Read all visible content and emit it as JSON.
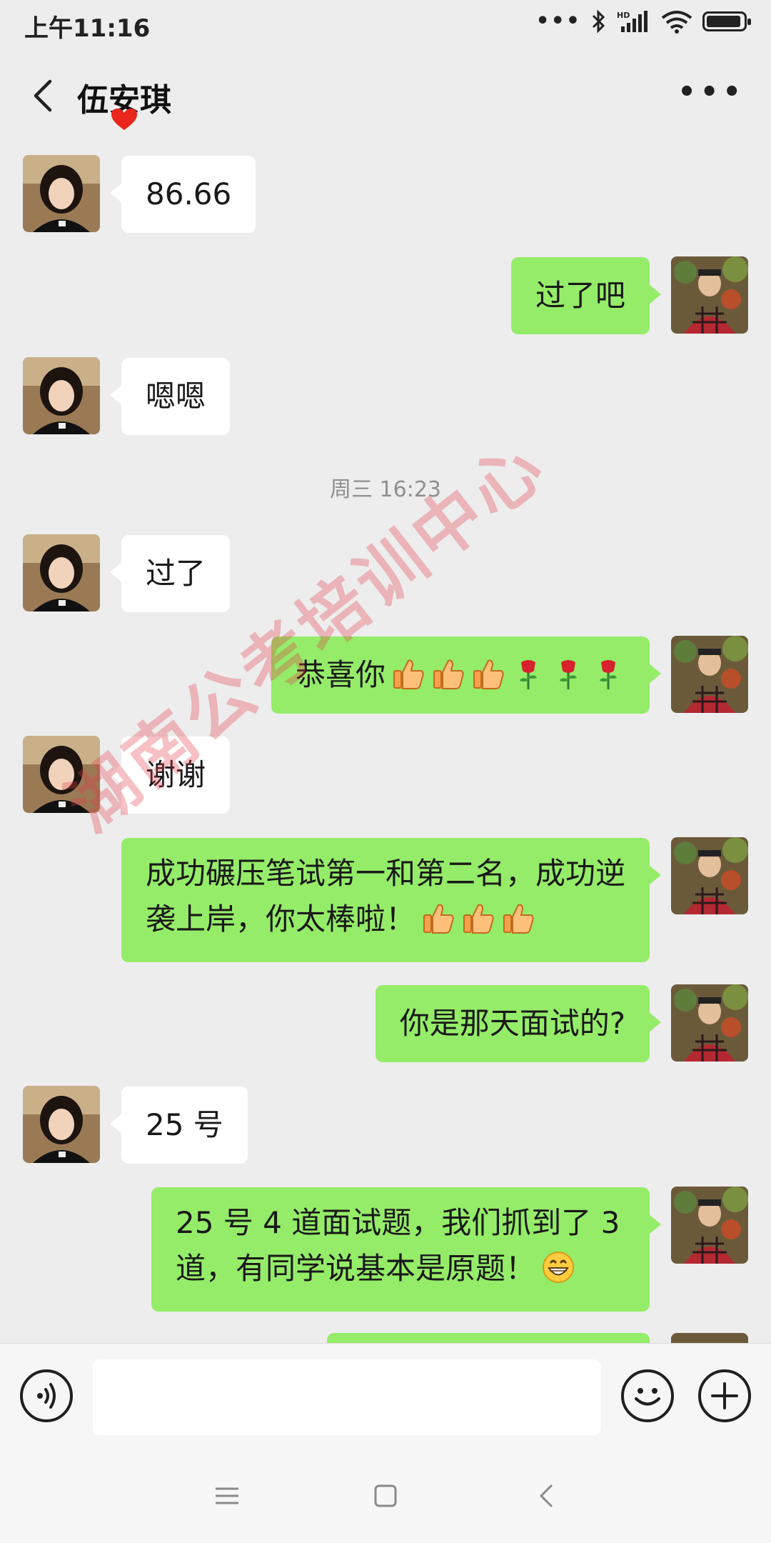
{
  "status_bar": {
    "time": "上午11:16",
    "icons": [
      "signal-dots-icon",
      "bluetooth-icon",
      "hd-signal-icon",
      "wifi-icon",
      "battery-icon"
    ]
  },
  "header": {
    "title": "伍安琪",
    "back_icon": "chevron-left-icon",
    "more_icon": "more-dots-icon"
  },
  "messages": [
    {
      "side": "left",
      "text": "86.66"
    },
    {
      "side": "right",
      "text": "过了吧"
    },
    {
      "side": "left",
      "text": "嗯嗯"
    },
    {
      "type": "timestamp",
      "text": "周三 16:23"
    },
    {
      "side": "left",
      "text": "过了"
    },
    {
      "side": "right",
      "text": "恭喜你",
      "emojis": [
        "thumbs-up",
        "thumbs-up",
        "thumbs-up",
        "rose",
        "rose",
        "rose"
      ]
    },
    {
      "side": "left",
      "text": "谢谢"
    },
    {
      "side": "right",
      "text": "成功碾压笔试第一和第二名，成功逆袭上岸，你太棒啦！",
      "emojis": [
        "thumbs-up",
        "thumbs-up",
        "thumbs-up"
      ]
    },
    {
      "side": "right",
      "text": "你是那天面试的?"
    },
    {
      "side": "left",
      "text": "25 号"
    },
    {
      "side": "right",
      "text": "25 号 4 道面试题，我们抓到了 3 道，有同学说基本是原题！",
      "emojis": [
        "grin"
      ]
    }
  ],
  "input_bar": {
    "placeholder": "",
    "voice_icon": "voice-icon",
    "emoji_icon": "emoji-icon",
    "plus_icon": "plus-icon"
  },
  "watermark": {
    "text": "湖南公考培训中心"
  },
  "colors": {
    "background": "#ededed",
    "sent_bubble": "#95ec69",
    "received_bubble": "#ffffff"
  }
}
